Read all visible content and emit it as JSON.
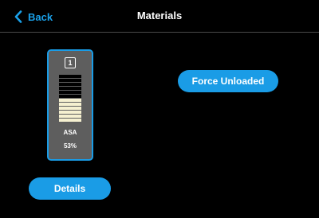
{
  "header": {
    "back_label": "Back",
    "back_icon": "chevron-left-icon",
    "title": "Materials"
  },
  "spool": {
    "bay_number": "1",
    "material_type": "ASA",
    "material_level_text": "53%",
    "level_fraction": 0.53,
    "segments_total": 12,
    "colors": {
      "filled": "#f5f0d0",
      "empty": "#000000",
      "card": "#5e5e5e",
      "border": "#1a9ce6"
    }
  },
  "actions": {
    "force_unloaded_label": "Force Unloaded",
    "details_label": "Details"
  },
  "colors": {
    "accent": "#1a9ce6",
    "background": "#000000"
  }
}
